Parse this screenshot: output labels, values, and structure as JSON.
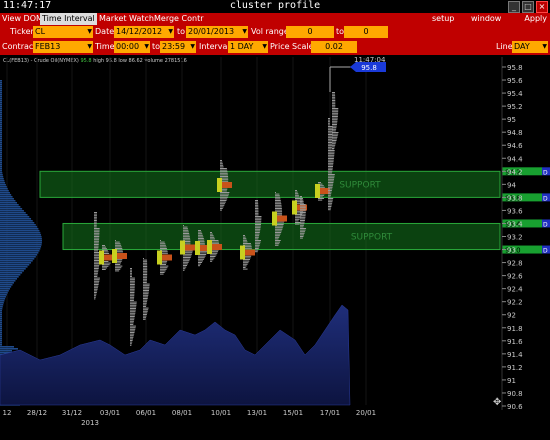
{
  "window": {
    "clock": "11:47:17",
    "title": "cluster profile",
    "btn_min": "_",
    "btn_max": "□",
    "btn_close": "×"
  },
  "menu": {
    "items": [
      "View DOM",
      "Time Interval",
      "Market Watch",
      "Merge Contr"
    ],
    "setup": "setup",
    "window": "window",
    "apply": "Apply"
  },
  "toolbar": {
    "ticker_label": "Ticker",
    "ticker": "CL",
    "date_label": "Date",
    "date_from": "14/12/2012",
    "date_to_label": "to",
    "date_to": "20/01/2013",
    "vol_range_label": "Vol range",
    "vol_from": "0",
    "vol_to_label": "to",
    "vol_to": "0",
    "contract_label": "Contract",
    "contract": "FEB13",
    "time_label": "Time",
    "time_from": "00:00",
    "time_to_label": "to",
    "time_to": "23:59",
    "interval_label": "Interval",
    "interval": "1 DAY",
    "price_scale_label": "Price Scale",
    "price_scale": "0.02",
    "line_label": "Line",
    "line": "DAY"
  },
  "chart_info": {
    "symbol": "CL(FEB13) - Crude Oil(NYMEX)",
    "last": "95.8",
    "high": "high 95.8",
    "low": "low 86.62",
    "volume": "volume 2781516"
  },
  "chart_data": {
    "type": "bar",
    "price_axis": [
      "95.8",
      "95.6",
      "95.4",
      "95.2",
      "95",
      "94.8",
      "94.6",
      "94.4",
      "94.2",
      "94",
      "93.8",
      "93.6",
      "93.4",
      "93.2",
      "93",
      "92.8",
      "92.6",
      "92.4",
      "92.2",
      "92",
      "91.8",
      "91.6",
      "91.4",
      "91.2",
      "91",
      "90.8",
      "90.6"
    ],
    "date_axis": [
      "12",
      "28/12",
      "31/12",
      "03/01",
      "06/01",
      "08/01",
      "10/01",
      "13/01",
      "15/01",
      "17/01",
      "20/01"
    ],
    "year_label": "2013",
    "current_time": "11:47:04",
    "current_price": "95.8",
    "zones": [
      {
        "label": "SUPPORT",
        "price_hi": 94.2,
        "price_lo": 93.8,
        "tag_hi": "94.2",
        "tag_lo": "93.8"
      },
      {
        "label": "SUPPORT",
        "price_hi": 93.4,
        "price_lo": 93.0,
        "tag_hi": "93.4",
        "tag_lo": "93.0"
      }
    ]
  }
}
